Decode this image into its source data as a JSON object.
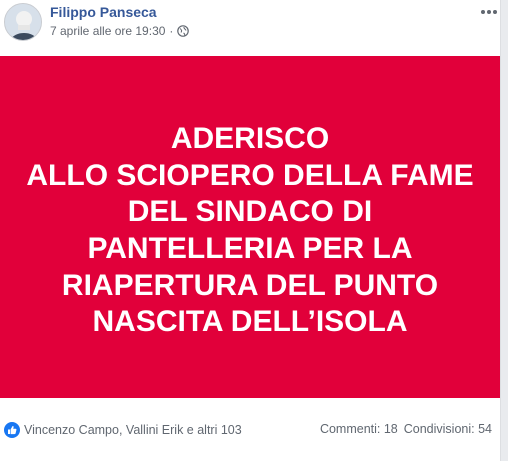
{
  "post": {
    "author": "Filippo Panseca",
    "timestamp": "7 aprile alle ore 19:30",
    "separator": "·",
    "privacy_icon": "globe-icon",
    "more_icon": "more-options-icon",
    "image": {
      "background": "#e1003a",
      "text_color": "#ffffff",
      "lines": [
        "ADERISCO",
        "ALLO SCIOPERO DELLA FAME",
        "DEL SINDACO DI",
        "PANTELLERIA PER LA",
        "RIAPERTURA DEL PUNTO",
        "NASCITA DELL’ISOLA"
      ]
    }
  },
  "footer": {
    "reaction_icon": "like-icon",
    "reactions_text": "Vincenzo Campo, Vallini Erik e altri 103",
    "comments": "Commenti: 18",
    "shares": "Condivisioni: 54"
  },
  "colors": {
    "link": "#365899",
    "meta": "#616770",
    "accent": "#1877f2"
  }
}
